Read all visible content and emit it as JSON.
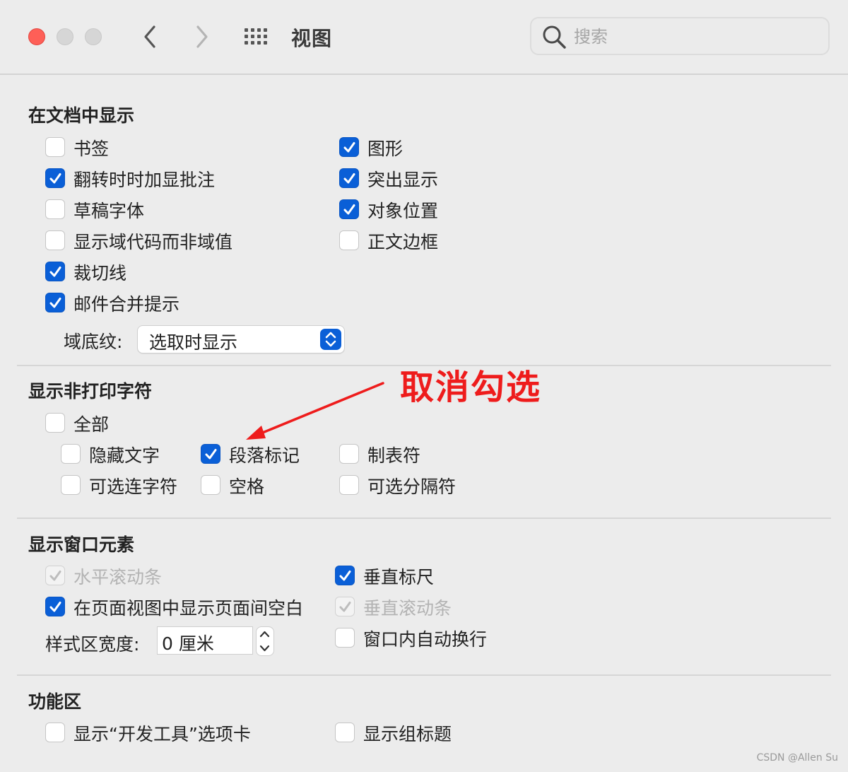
{
  "window": {
    "title": "视图",
    "search_placeholder": "搜索"
  },
  "icons": {
    "close": "close-icon",
    "back": "chevron-left-icon",
    "forward": "chevron-right-icon",
    "show_all": "grid-icon",
    "search": "search-icon",
    "checkmark": "checkmark-icon",
    "popup_arrows": "up-down-chevron-icon"
  },
  "colors": {
    "accent": "#0a5fd7",
    "close": "#fe5f57",
    "annotation": "#ee1c1c"
  },
  "sections": {
    "show_in_document": {
      "title": "在文档中显示",
      "options": {
        "bookmarks": {
          "label": "书签",
          "checked": false
        },
        "comments_on_rollover": {
          "label": "翻转时时加显批注",
          "checked": true
        },
        "draft_font": {
          "label": "草稿字体",
          "checked": false
        },
        "field_codes": {
          "label": "显示域代码而非域值",
          "checked": false
        },
        "crop_marks": {
          "label": "裁切线",
          "checked": true
        },
        "mail_merge": {
          "label": "邮件合并提示",
          "checked": true
        },
        "drawings": {
          "label": "图形",
          "checked": true
        },
        "highlight": {
          "label": "突出显示",
          "checked": true
        },
        "object_anchors": {
          "label": "对象位置",
          "checked": true
        },
        "text_boundaries": {
          "label": "正文边框",
          "checked": false
        }
      },
      "field_shading": {
        "label": "域底纹:",
        "value": "选取时显示"
      }
    },
    "nonprinting": {
      "title": "显示非打印字符",
      "options": {
        "all": {
          "label": "全部",
          "checked": false
        },
        "hidden_text": {
          "label": "隐藏文字",
          "checked": false
        },
        "paragraph_marks": {
          "label": "段落标记",
          "checked": true
        },
        "tab_characters": {
          "label": "制表符",
          "checked": false
        },
        "optional_hyphens": {
          "label": "可选连字符",
          "checked": false
        },
        "spaces": {
          "label": "空格",
          "checked": false
        },
        "optional_breaks": {
          "label": "可选分隔符",
          "checked": false
        }
      }
    },
    "window_elements": {
      "title": "显示窗口元素",
      "options": {
        "horizontal_scrollbar": {
          "label": "水平滚动条",
          "checked": true,
          "enabled": false
        },
        "white_space": {
          "label": "在页面视图中显示页面间空白",
          "checked": true,
          "enabled": true
        },
        "vertical_ruler": {
          "label": "垂直标尺",
          "checked": true,
          "enabled": true
        },
        "vertical_scrollbar": {
          "label": "垂直滚动条",
          "checked": true,
          "enabled": false
        },
        "wrap_to_window": {
          "label": "窗口内自动换行",
          "checked": false,
          "enabled": true
        }
      },
      "style_area_width": {
        "label": "样式区宽度:",
        "value": "0 厘米"
      }
    },
    "ribbon": {
      "title": "功能区",
      "options": {
        "developer_tab": {
          "label": "显示“开发工具”选项卡",
          "checked": false
        },
        "group_titles": {
          "label": "显示组标题",
          "checked": false
        }
      }
    }
  },
  "annotation": {
    "text": "取消勾选"
  },
  "watermark": "CSDN @Allen Su"
}
